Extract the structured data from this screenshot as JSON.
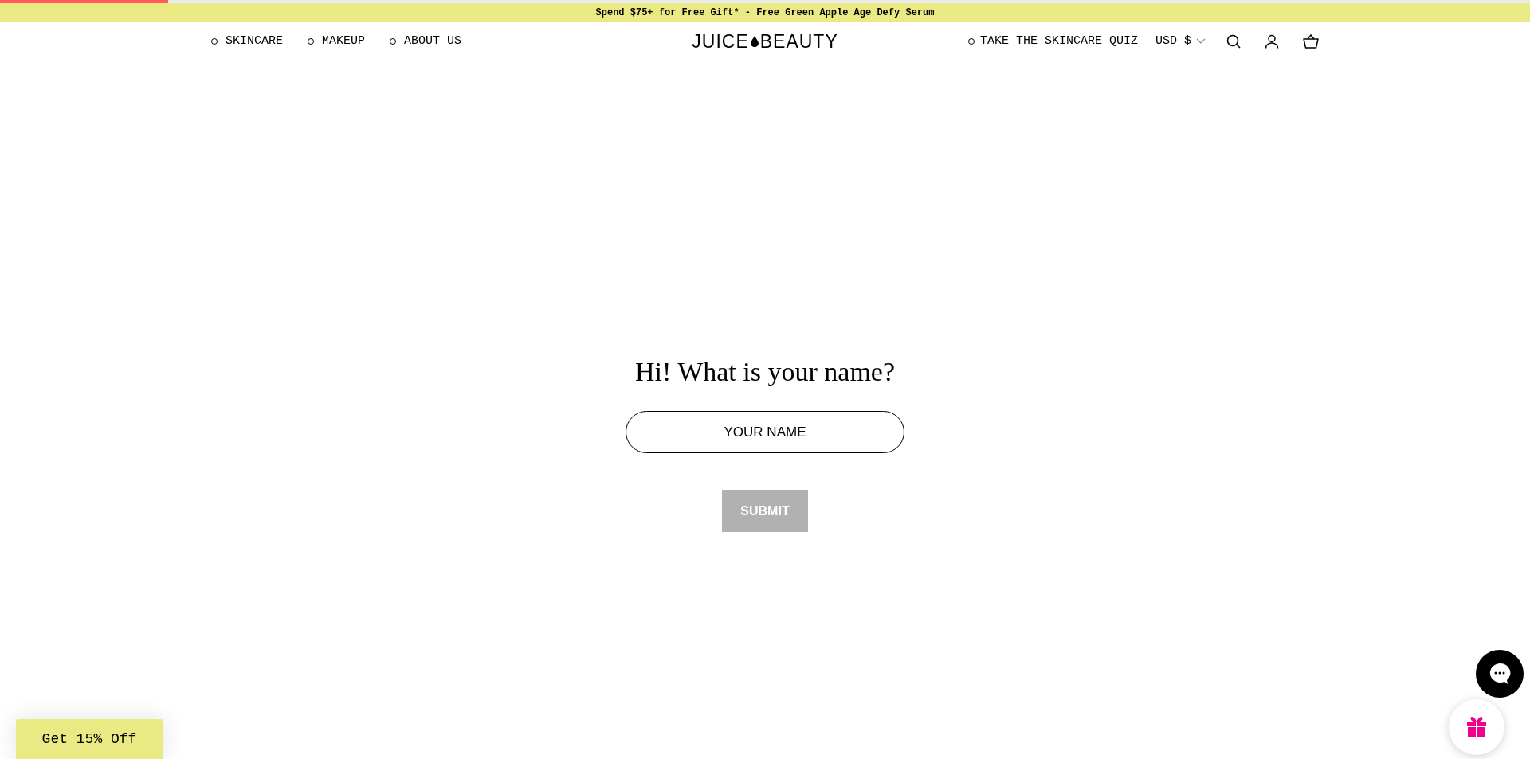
{
  "progress": {
    "level": 0.11
  },
  "banner": {
    "text": "Spend $75+ for Free Gift* - Free Green Apple Age Defy Serum"
  },
  "nav_left": [
    {
      "label": "SKINCARE"
    },
    {
      "label": "MAKEUP"
    },
    {
      "label": "ABOUT US"
    }
  ],
  "logo": {
    "left": "JUICE",
    "right": "BEAUTY"
  },
  "nav_right": {
    "quiz": "TAKE THE SKINCARE QUIZ",
    "currency": "USD $"
  },
  "form": {
    "heading": "Hi! What is your name?",
    "placeholder": "YOUR NAME",
    "submit": {
      "label": "SUBMIT",
      "disabled": true
    }
  },
  "promo": {
    "label": "Get 15% Off"
  }
}
